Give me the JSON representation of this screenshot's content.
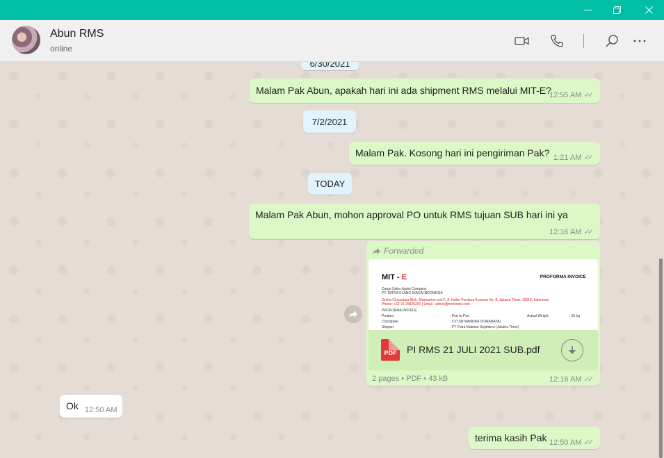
{
  "window": {
    "minimize_glyph": "—",
    "restore_glyph": "❐",
    "close_glyph": "✕"
  },
  "header": {
    "contact_name": "Abun RMS",
    "status": "online",
    "icons": [
      "video-call-icon",
      "voice-call-icon",
      "search-icon",
      "more-options-icon"
    ]
  },
  "chat": {
    "date_chips": {
      "top": "6/30/2021",
      "second": "7/2/2021",
      "today": "TODAY"
    },
    "messages": [
      {
        "text": "Malam Pak Abun, apakah hari ini ada shipment RMS melalui MIT-E?",
        "time": "12:55 AM",
        "direction": "out"
      },
      {
        "text": "Malam Pak. Kosong hari ini pengiriman Pak?",
        "time": "1:21 AM",
        "direction": "out"
      },
      {
        "text": "Malam Pak Abun, mohon approval PO untuk RMS tujuan SUB hari ini ya",
        "time": "12:16 AM",
        "direction": "out"
      },
      {
        "text": "Ok",
        "time": "12:50 AM",
        "direction": "in"
      },
      {
        "text": "terima kasih Pak",
        "time": "12:50 AM",
        "direction": "out"
      }
    ],
    "document": {
      "forwarded_label": "Forwarded",
      "file_name": "PI RMS 21 JULI 2021 SUB.pdf",
      "file_type_badge": "PDF",
      "file_info": "2 pages • PDF • 43 kB",
      "time": "12:16 AM",
      "preview": {
        "logo_prefix": "MIT - ",
        "logo_accent": "E",
        "title": "PROFORMA INVOICE",
        "company_tag": "Cargo Sales Agent Company",
        "company_name": "PT. MITRA ELANG NIAGA INDONESIA",
        "address": "Graha Cinyantara Blok, Mezzanine unit F, Jl. Halim Perdana Kusuma No. 8, Jakarta Timur, 13610, Indonesia",
        "contact": "Phone: +62 21 25825200 | Email : admin@meniindo.com",
        "section": "PROFORMA INVOICE",
        "row1_label": "Product",
        "row1_value": ": Port to Port",
        "row1_extra": "Actual Weight",
        "row1_extra_value": ": 55 kg",
        "row2_label": "Consignee",
        "row2_value": ": CV ISN MANDIRI (SURABAYA)",
        "row3_label": "Shipper",
        "row3_value": ": PT Putra Makmur Sejahtera (Jakarta Timur)"
      }
    }
  },
  "colors": {
    "titlebar": "#00bfa5",
    "outgoing_bubble": "#dcf8c6",
    "incoming_bubble": "#ffffff",
    "date_chip": "#e1f3fb",
    "chat_background": "#e5ddd5"
  }
}
